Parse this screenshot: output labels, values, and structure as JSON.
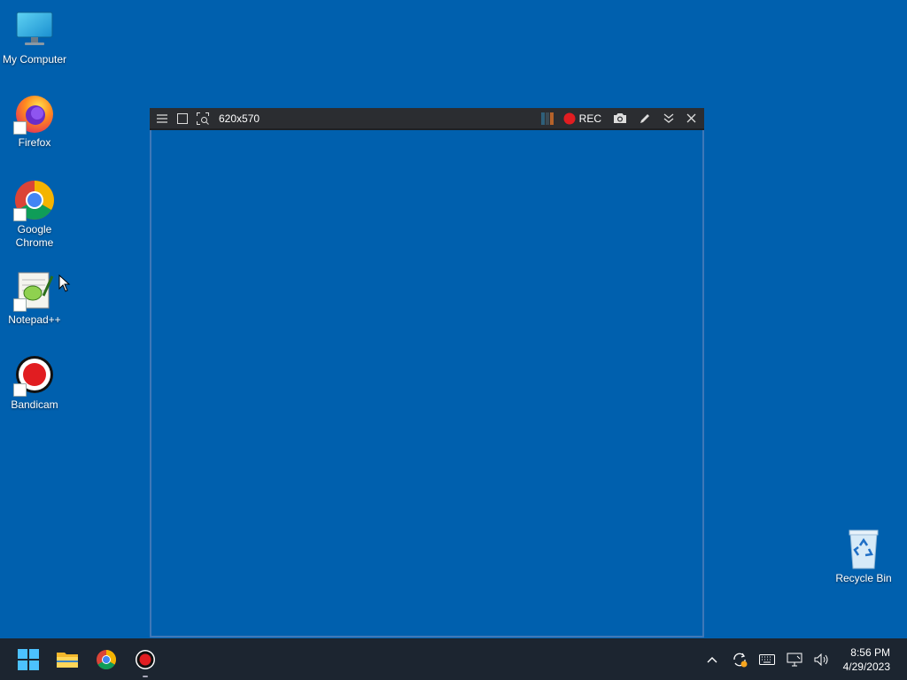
{
  "desktop": {
    "icons": [
      {
        "label": "My Computer"
      },
      {
        "label": "Firefox"
      },
      {
        "label": "Google Chrome"
      },
      {
        "label": "Notepad++"
      },
      {
        "label": "Bandicam"
      },
      {
        "label": "Recycle Bin"
      }
    ]
  },
  "bandicam": {
    "size_label": "620x570",
    "rec_label": "REC",
    "colors": {
      "rec": "#e11d21",
      "toolbar": "#2b2d31",
      "border": "#3f78b8"
    }
  },
  "taskbar": {
    "pinned": [
      "start-button",
      "file-explorer",
      "google-chrome",
      "bandicam"
    ],
    "clock": {
      "time": "8:56 PM",
      "date": "4/29/2023"
    }
  },
  "colors": {
    "desktop": "#0060ae",
    "taskbar": "#1c2530"
  }
}
